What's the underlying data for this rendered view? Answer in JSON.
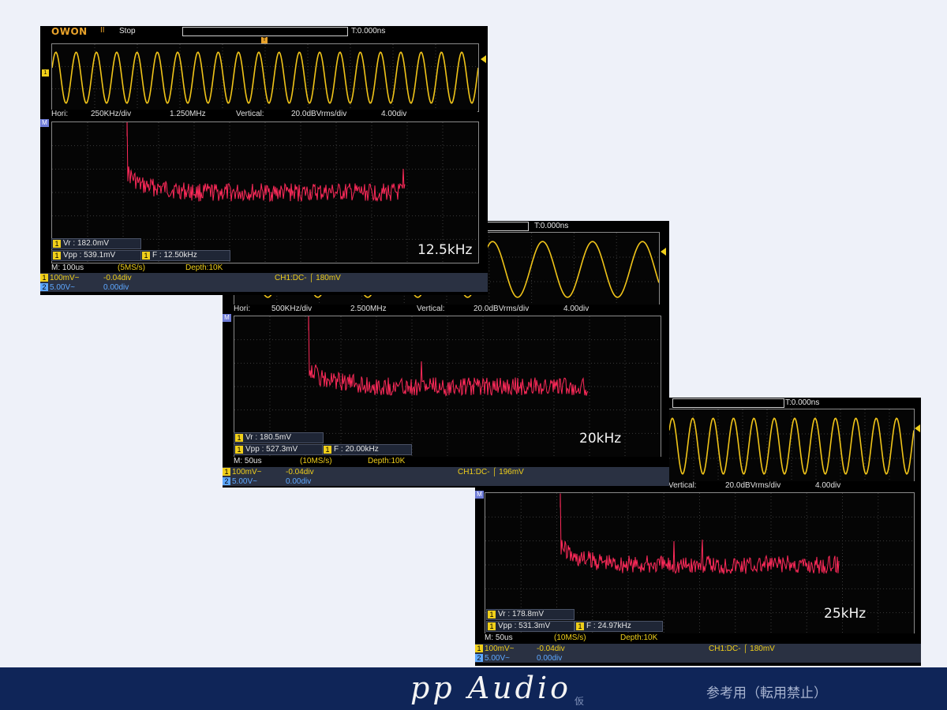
{
  "scopes": [
    {
      "brand": "OWON",
      "run_icon": "II",
      "run_state": "Stop",
      "trigger_time": "T:0.000ns",
      "hori_label": "Hori:",
      "hori_div": "250KHz/div",
      "center_freq": "1.250MHz",
      "vertical_label": "Vertical:",
      "vert_div": "20.0dBVrms/div",
      "vert_offset": "4.00div",
      "meas": {
        "vr": "Vr : 182.0mV",
        "vpp": "Vpp : 539.1mV",
        "f": "F : 12.50kHz"
      },
      "freq_label": "12.5kHz",
      "timebase": "M: 100us",
      "sample_rate": "(5MS/s)",
      "depth": "Depth:10K",
      "ch1_scale": "100mV~",
      "ch1_offset": "-0.04div",
      "trigger": "CH1:DC- ⌠ 180mV",
      "ch2_scale": "5.00V~",
      "ch2_offset": "0.00div"
    },
    {
      "trigger_time": "T:0.000ns",
      "hori_label": "Hori:",
      "hori_div": "500KHz/div",
      "center_freq": "2.500MHz",
      "vertical_label": "Vertical:",
      "vert_div": "20.0dBVrms/div",
      "vert_offset": "4.00div",
      "meas": {
        "vr": "Vr : 180.5mV",
        "vpp": "Vpp : 527.3mV",
        "f": "F : 20.00kHz"
      },
      "freq_label": "20kHz",
      "timebase": "M: 50us",
      "sample_rate": "(10MS/s)",
      "depth": "Depth:10K",
      "ch1_scale": "100mV~",
      "ch1_offset": "-0.04div",
      "trigger": "CH1:DC- ⌠ 196mV",
      "ch2_scale": "5.00V~",
      "ch2_offset": "0.00div"
    },
    {
      "trigger_time": "T:0.000ns",
      "vertical_label": "Vertical:",
      "vert_div": "20.0dBVrms/div",
      "vert_offset": "4.00div",
      "meas": {
        "vr": "Vr : 178.8mV",
        "vpp": "Vpp : 531.3mV",
        "f": "F : 24.97kHz"
      },
      "freq_label": "25kHz",
      "timebase": "M: 50us",
      "sample_rate": "(10MS/s)",
      "depth": "Depth:10K",
      "ch1_scale": "100mV~",
      "ch1_offset": "-0.04div",
      "trigger": "CH1:DC- ⌠ 180mV",
      "ch2_scale": "5.00V~",
      "ch2_offset": "0.00div"
    }
  ],
  "footer": {
    "logo": "pp Audio",
    "kari": "仮",
    "reference": "参考用（転用禁止）"
  },
  "colors": {
    "waveform": "#f0c419",
    "spectrum": "#ff2a5a",
    "footer_bg": "#0f2558",
    "page_bg": "#eef1f9"
  }
}
